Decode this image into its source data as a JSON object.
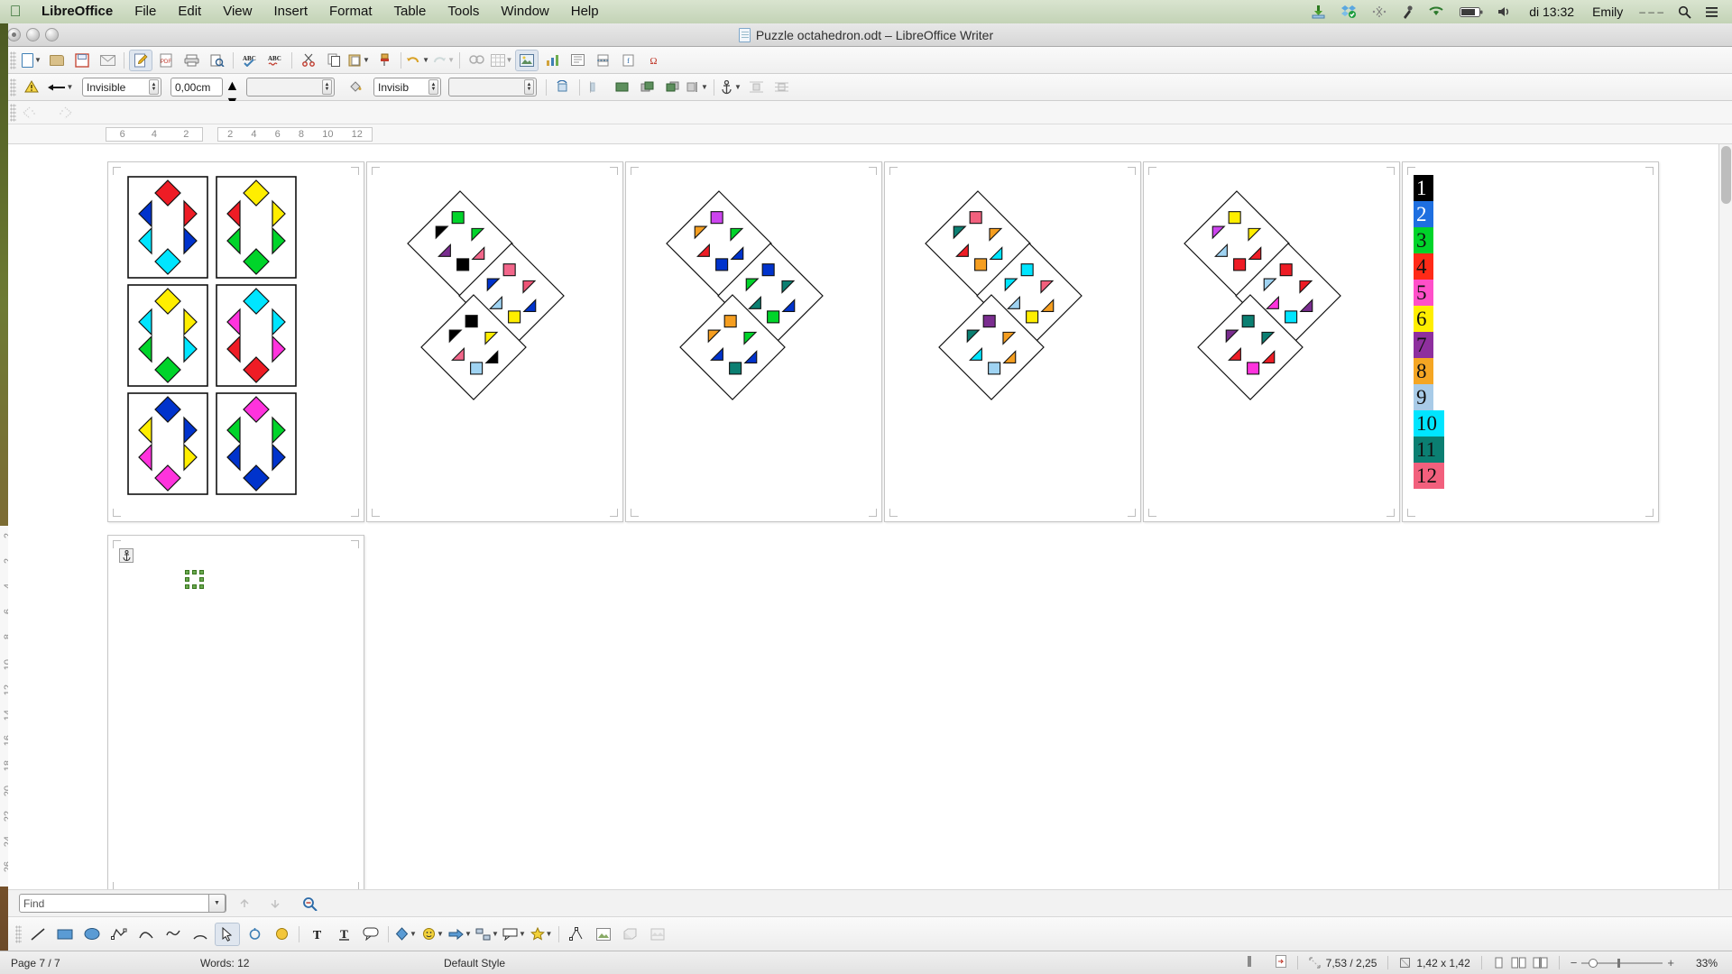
{
  "menubar": {
    "apple_icon": "apple-logo",
    "items": [
      "LibreOffice",
      "File",
      "Edit",
      "View",
      "Insert",
      "Format",
      "Table",
      "Tools",
      "Window",
      "Help"
    ],
    "status_icons": [
      "download-icon",
      "dropbox-icon",
      "bluetooth-icon",
      "eyedropper-icon",
      "wifi-icon",
      "battery-icon",
      "volume-icon"
    ],
    "clock": "di 13:32",
    "user": "Emily",
    "user_suffix": "– – –",
    "spotlight_icon": "search-icon",
    "notification_icon": "list-icon"
  },
  "titlebar": {
    "title": "Puzzle octahedron.odt – LibreOffice Writer",
    "doc_icon": "document-icon",
    "close_label": "close",
    "minimize_label": "minimize",
    "zoom_label": "zoom"
  },
  "toolbar_standard": {
    "items": [
      {
        "name": "new-document",
        "glyph": "doc"
      },
      {
        "name": "open-document",
        "glyph": "folder"
      },
      {
        "name": "save-document",
        "glyph": "save"
      },
      {
        "name": "email-document",
        "glyph": "envelope"
      },
      {
        "name": "edit-mode-toggle",
        "glyph": "pencil-doc",
        "selected": true
      },
      {
        "name": "export-pdf",
        "glyph": "pdf"
      },
      {
        "name": "print-document",
        "glyph": "printer"
      },
      {
        "name": "print-preview",
        "glyph": "preview"
      },
      {
        "name": "spelling-check",
        "glyph": "abc-check"
      },
      {
        "name": "autospellcheck",
        "glyph": "abc-red"
      },
      {
        "name": "cut",
        "glyph": "scissors"
      },
      {
        "name": "copy",
        "glyph": "copy"
      },
      {
        "name": "paste",
        "glyph": "clipboard"
      },
      {
        "name": "clone-formatting",
        "glyph": "brush"
      },
      {
        "name": "undo",
        "glyph": "undo-arrow"
      },
      {
        "name": "redo",
        "glyph": "redo-arrow"
      },
      {
        "name": "find-replace",
        "glyph": "binoculars"
      },
      {
        "name": "insert-table",
        "glyph": "table"
      },
      {
        "name": "insert-image",
        "glyph": "image",
        "selected": true
      },
      {
        "name": "insert-chart",
        "glyph": "chart"
      },
      {
        "name": "insert-text-box",
        "glyph": "textbox"
      },
      {
        "name": "insert-page-break",
        "glyph": "pagebreak"
      },
      {
        "name": "insert-field",
        "glyph": "field"
      },
      {
        "name": "insert-special-char",
        "glyph": "omega"
      }
    ]
  },
  "toolbar_drawing_props": {
    "warning_icon": "warning-icon",
    "arrow_style_label": "arrow-style",
    "line_style": {
      "value": "Invisible",
      "name": "line-style-select"
    },
    "line_width": {
      "value": "0,00cm",
      "name": "line-width-input"
    },
    "line_color": {
      "value": "",
      "name": "line-color-select"
    },
    "area_style_icon": "paint-can-icon",
    "fill_style": {
      "value": "Invisib",
      "name": "area-style-select"
    },
    "fill_color": {
      "value": "",
      "name": "area-color-select"
    },
    "rotate_icon": "rotate-icon",
    "align_icons": [
      "align-left-icon",
      "align-center-icon",
      "align-right-icon"
    ],
    "arrange_icons": [
      "bring-forward-icon",
      "send-backward-icon"
    ],
    "anchor_icon": "anchor-icon",
    "wrap_icons": [
      "wrap-off-icon",
      "wrap-through-icon"
    ]
  },
  "ruler": {
    "horizontal_left_ticks": [
      "6",
      "4",
      "2"
    ],
    "horizontal_right_ticks": [
      "2",
      "4",
      "6",
      "8",
      "10",
      "12"
    ],
    "vertical_ticks": [
      "2",
      "2",
      "4",
      "6",
      "8",
      "10",
      "12",
      "14",
      "16",
      "18",
      "20",
      "22",
      "24",
      "26"
    ]
  },
  "document": {
    "pages": [
      {
        "name": "page-grid-tiles",
        "kind": "grid",
        "tiles": [
          {
            "top": "#ee1c25",
            "bottom": "#00e5ff",
            "left_top": "#0033cc",
            "left_bottom": "#00e5ff",
            "right_top": "#ee1c25",
            "right_bottom": "#0033cc"
          },
          {
            "top": "#ffee00",
            "bottom": "#00d42a",
            "left_top": "#ee1c25",
            "left_bottom": "#00d42a",
            "right_top": "#ffee00",
            "right_bottom": "#00d42a"
          },
          {
            "top": "#ffee00",
            "bottom": "#00d42a",
            "left_top": "#00e5ff",
            "left_bottom": "#00d42a",
            "right_top": "#ffee00",
            "right_bottom": "#00e5ff"
          },
          {
            "top": "#00e5ff",
            "bottom": "#ee1c25",
            "left_top": "#ff33dd",
            "left_bottom": "#ee1c25",
            "right_top": "#00e5ff",
            "right_bottom": "#ff33dd"
          },
          {
            "top": "#0033cc",
            "bottom": "#ff33dd",
            "left_top": "#ffee00",
            "left_bottom": "#ff33dd",
            "right_top": "#0033cc",
            "right_bottom": "#ffee00"
          },
          {
            "top": "#ff33dd",
            "bottom": "#0033cc",
            "left_top": "#00d42a",
            "left_bottom": "#0033cc",
            "right_top": "#00d42a",
            "right_bottom": "#0033cc"
          }
        ]
      },
      {
        "name": "page-octahedron-1",
        "kind": "octa",
        "squares": [
          "#00d42a",
          "#000000",
          "#000000",
          "#f2668a",
          "#7a2d8f",
          "#ffee00",
          "#000000",
          "#0033cc",
          "#9fd3f2"
        ],
        "tris": [
          "#00d42a",
          "#000000",
          "#ee5577",
          "#0033cc",
          "#ffee00",
          "#000000",
          "#7a2d8f"
        ]
      },
      {
        "name": "page-octahedron-2",
        "kind": "octa",
        "squares": [
          "#cc44ee",
          "#00d42a",
          "#0033cc",
          "#0033cc",
          "#ee1c25",
          "#00d42a",
          "#f59e20",
          "#0033cc",
          "#0b7f72"
        ],
        "tris": [
          "#00d42a",
          "#f59e20",
          "#0b7f72",
          "#00d42a"
        ]
      },
      {
        "name": "page-octahedron-3",
        "kind": "octa",
        "squares": [
          "#f2607d",
          "#0b7f72",
          "#f59e20",
          "#00e5ff",
          "#ee1c25",
          "#ffee00",
          "#7a2d8f",
          "#f59e20",
          "#9fd3f2"
        ],
        "tris": [
          "#f59e20",
          "#0b7f72",
          "#f2607d",
          "#00e5ff"
        ]
      },
      {
        "name": "page-octahedron-4",
        "kind": "octa",
        "squares": [
          "#ffee00",
          "#cc44ee",
          "#ee1c25",
          "#ee1c25",
          "#9fd3f2",
          "#00e5ff",
          "#0b7f72",
          "#7a2d8f",
          "#ff33dd"
        ],
        "tris": [
          "#ffee00",
          "#cc44ee",
          "#ee1c25",
          "#9fd3f2",
          "#0b7f72",
          "#7a2d8f"
        ]
      },
      {
        "name": "page-legend",
        "kind": "legend"
      },
      {
        "name": "page-blank-selected",
        "kind": "blank"
      }
    ],
    "legend": [
      {
        "num": "1",
        "bg": "#000000",
        "fg": "#ffffff"
      },
      {
        "num": "2",
        "bg": "#1e6fe0",
        "fg": "#ffffff"
      },
      {
        "num": "3",
        "bg": "#00d42a",
        "fg": "#111111"
      },
      {
        "num": "4",
        "bg": "#ff2a17",
        "fg": "#111111"
      },
      {
        "num": "5",
        "bg": "#ff4fc9",
        "fg": "#111111"
      },
      {
        "num": "6",
        "bg": "#ffee00",
        "fg": "#111111"
      },
      {
        "num": "7",
        "bg": "#8e2f9e",
        "fg": "#111111"
      },
      {
        "num": "8",
        "bg": "#f5a623",
        "fg": "#111111"
      },
      {
        "num": "9",
        "bg": "#a8cbe8",
        "fg": "#111111"
      },
      {
        "num": "10",
        "bg": "#00e5ff",
        "fg": "#111111"
      },
      {
        "num": "11",
        "bg": "#0b7f72",
        "fg": "#111111"
      },
      {
        "num": "12",
        "bg": "#f2607d",
        "fg": "#111111"
      }
    ]
  },
  "findbar": {
    "placeholder": "Find",
    "value": "",
    "dropdown_icon": "chevron-down-icon",
    "prev_icon": "find-previous-icon",
    "next_icon": "find-next-icon",
    "findall_icon": "find-and-replace-icon"
  },
  "drawbar": {
    "items": [
      {
        "name": "line-tool",
        "glyph": "line"
      },
      {
        "name": "rectangle-tool",
        "glyph": "rect"
      },
      {
        "name": "ellipse-tool",
        "glyph": "ellipse"
      },
      {
        "name": "polygon-tool",
        "glyph": "polygon"
      },
      {
        "name": "curve-tool",
        "glyph": "curve"
      },
      {
        "name": "freeform-tool",
        "glyph": "freeform"
      },
      {
        "name": "arc-tool",
        "glyph": "arc"
      },
      {
        "name": "select-tool",
        "glyph": "arrow",
        "selected": true
      },
      {
        "name": "rotate-tool",
        "glyph": "rotate"
      },
      {
        "name": "fontwork-tool",
        "glyph": "fontwork"
      },
      {
        "name": "text-box-tool",
        "glyph": "text-T"
      },
      {
        "name": "callout-tool",
        "glyph": "callout-T"
      },
      {
        "name": "vertical-text-tool",
        "glyph": "vtext"
      },
      {
        "name": "callouts-tool",
        "glyph": "speech"
      },
      {
        "name": "basic-shapes",
        "glyph": "diamond"
      },
      {
        "name": "symbol-shapes",
        "glyph": "smiley"
      },
      {
        "name": "block-arrows",
        "glyph": "arrow-block"
      },
      {
        "name": "flowchart-shapes",
        "glyph": "flow"
      },
      {
        "name": "callout-shapes",
        "glyph": "callout"
      },
      {
        "name": "stars-shapes",
        "glyph": "star"
      },
      {
        "name": "points-toggle",
        "glyph": "points"
      },
      {
        "name": "gallery-toggle",
        "glyph": "gallery"
      },
      {
        "name": "extrusion-toggle",
        "glyph": "extrusion"
      },
      {
        "name": "filter-toggle",
        "glyph": "filter"
      }
    ]
  },
  "statusbar": {
    "page": "Page 7 / 7",
    "words": "Words: 12",
    "style": "Default Style",
    "language": "",
    "insert_mode_icon": "insert-mode-icon",
    "selection_mode_icon": "selection-mode-icon",
    "save_state_icon": "modified-icon",
    "position": "7,53 / 2,25",
    "size": "1,42 x 1,42",
    "view_layout_icons": [
      "single-page-view-icon",
      "multi-page-view-icon",
      "book-view-icon"
    ],
    "zoom_out_icon": "zoom-out-icon",
    "zoom_in_icon": "zoom-in-icon",
    "zoom_level": "33%"
  }
}
